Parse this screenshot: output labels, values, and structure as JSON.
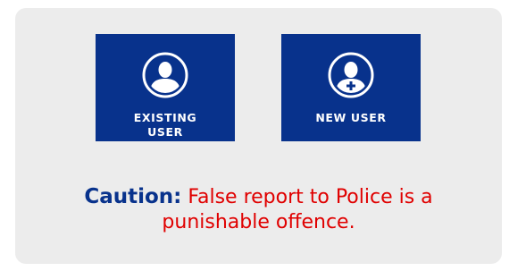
{
  "tiles": {
    "existing_user": {
      "label_line1": "EXISTING",
      "label_line2": "USER",
      "icon": "user-icon"
    },
    "new_user": {
      "label": "NEW USER",
      "icon": "user-add-icon"
    }
  },
  "caution": {
    "label": "Caution:",
    "message": "False report to Police is a punishable offence."
  },
  "colors": {
    "tile_background": "#08328c",
    "panel_background": "#ececec",
    "caution_label": "#08328c",
    "caution_message": "#e00000"
  }
}
